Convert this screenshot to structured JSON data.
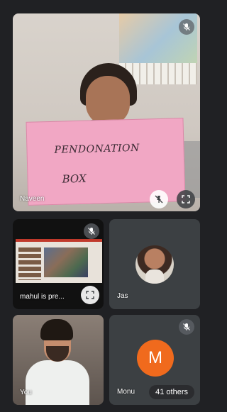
{
  "main_tile": {
    "participant_name": "Naveen",
    "sign_text_line1": "PENDONATION",
    "sign_text_line2": "BOX",
    "mic_status": "muted",
    "pin_button_icon": "pin-off-icon",
    "expand_button_icon": "fullscreen-icon"
  },
  "presentation_tile": {
    "label": "mahul is pre...",
    "mic_status": "muted",
    "expand_button_icon": "fullscreen-icon"
  },
  "jas_tile": {
    "participant_name": "Jas"
  },
  "you_tile": {
    "participant_name": "You"
  },
  "others_tile": {
    "participant_name": "Monu",
    "avatar_initial": "M",
    "avatar_color": "#f06a1d",
    "others_count_label": "41 others",
    "mic_status": "muted"
  },
  "colors": {
    "background": "#202124",
    "tile": "#3c4043"
  }
}
